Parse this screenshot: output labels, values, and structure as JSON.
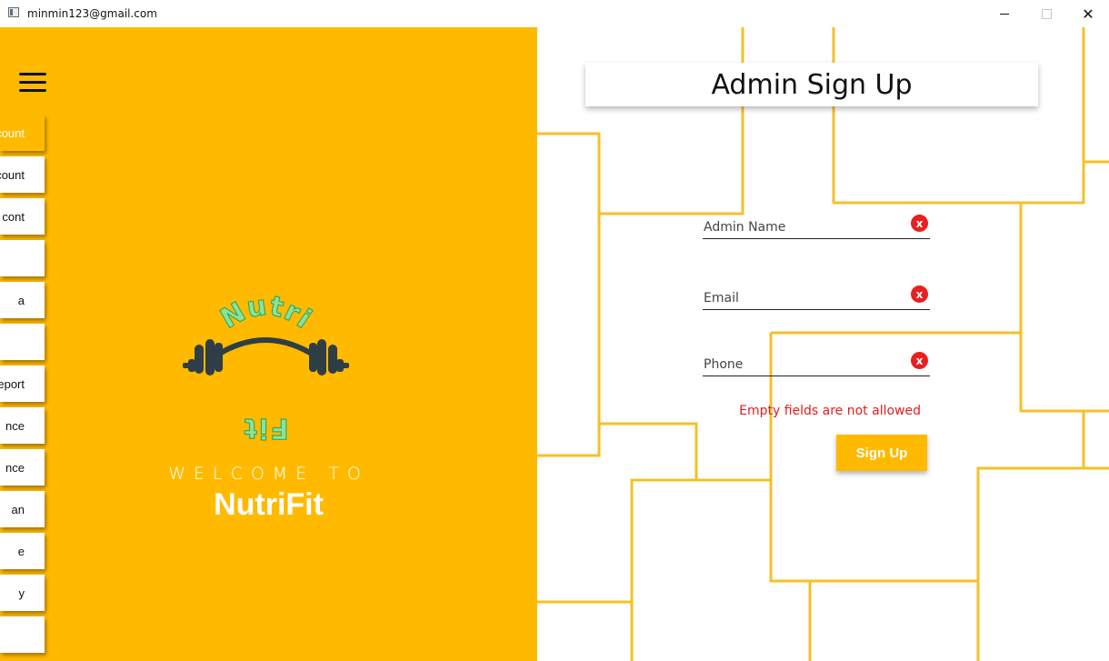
{
  "window": {
    "title": "minmin123@gmail.com",
    "minimize_icon": "minimize-icon",
    "maximize_icon": "maximize-icon",
    "close_glyph": "✕"
  },
  "sidebar": {
    "items": [
      {
        "label": "count",
        "active": true
      },
      {
        "label": "count"
      },
      {
        "label": "cont"
      },
      {
        "label": ""
      },
      {
        "label": "a"
      },
      {
        "label": ""
      },
      {
        "label": "eport"
      },
      {
        "label": "nce"
      },
      {
        "label": "nce"
      },
      {
        "label": "an"
      },
      {
        "label": "e"
      },
      {
        "label": "y"
      },
      {
        "label": ""
      }
    ]
  },
  "welcome": {
    "prefix": "WELCOME TO",
    "brand": "NutriFit"
  },
  "logo": {
    "top_text": "Nutri",
    "bottom_text": "Fit"
  },
  "form": {
    "title": "Admin Sign Up",
    "fields": [
      {
        "placeholder": "Admin Name"
      },
      {
        "placeholder": "Email"
      },
      {
        "placeholder": "Phone"
      }
    ],
    "clear_glyph": "x",
    "error": "Empty fields are not allowed",
    "submit_label": "Sign Up"
  },
  "colors": {
    "accent": "#ffba00",
    "error": "#e51c1c",
    "clear_icon": "#e82020"
  }
}
